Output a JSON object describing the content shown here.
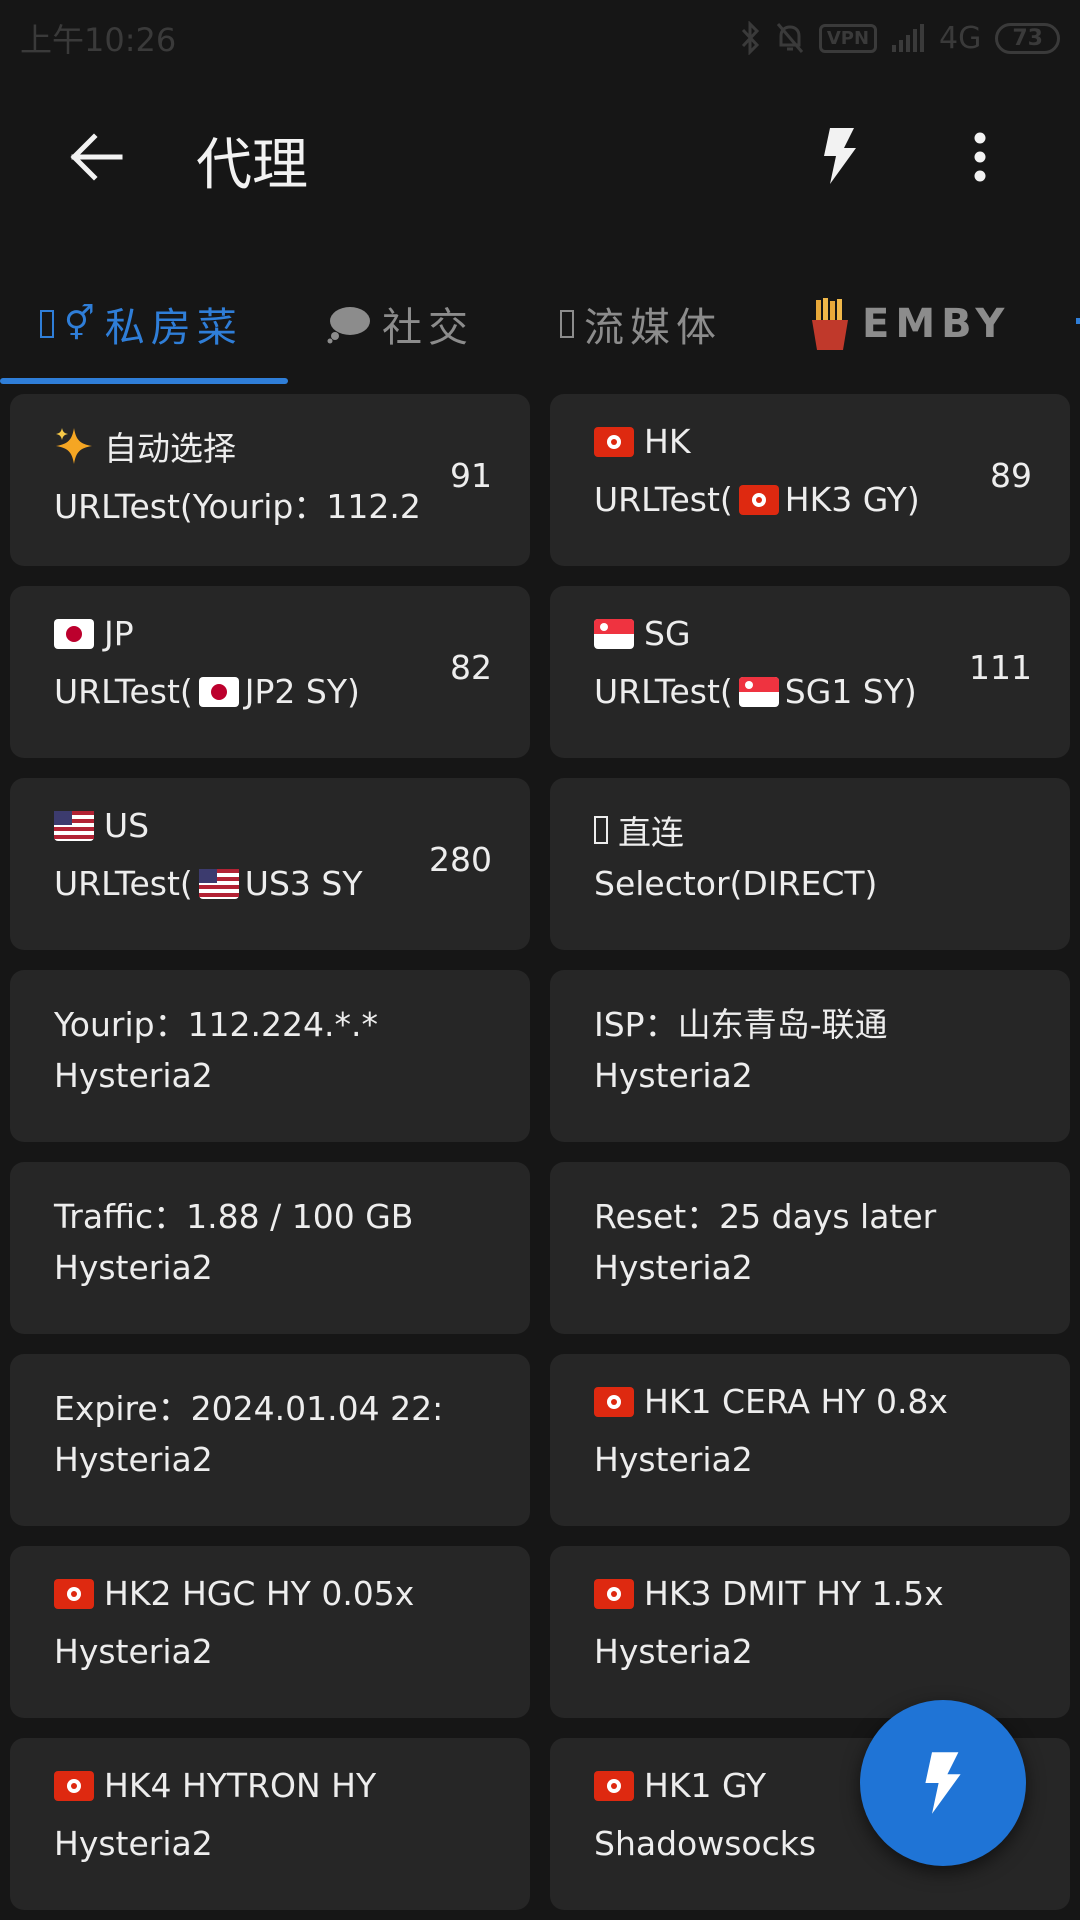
{
  "status_bar": {
    "time": "上午10:26",
    "vpn": "VPN",
    "network": "4G",
    "battery": "73"
  },
  "toolbar": {
    "title": "代理"
  },
  "tabs": [
    {
      "label": "私房菜",
      "active": true
    },
    {
      "label": "社交",
      "active": false
    },
    {
      "label": "流媒体",
      "active": false
    },
    {
      "label": "EMBY",
      "active": false
    }
  ],
  "colors": {
    "accent": "#2f7ed8",
    "card_bg": "#262626",
    "background": "#161616"
  },
  "cards": [
    {
      "icon": "sparkle",
      "name": "自动选择",
      "detail": "URLTest(Yourip：112.2",
      "latency": "91"
    },
    {
      "icon": "hk-flag",
      "name": "HK",
      "detail_prefix": "URLTest(",
      "detail_flag": "hk-flag",
      "detail_suffix": " HK3 GY)",
      "latency": "89"
    },
    {
      "icon": "jp-flag",
      "name": "JP",
      "detail_prefix": "URLTest(",
      "detail_flag": "jp-flag",
      "detail_suffix": " JP2 SY)",
      "latency": "82"
    },
    {
      "icon": "sg-flag",
      "name": "SG",
      "detail_prefix": "URLTest(",
      "detail_flag": "sg-flag",
      "detail_suffix": " SG1 SY)",
      "latency": "111"
    },
    {
      "icon": "us-flag",
      "name": "US",
      "detail_prefix": "URLTest(",
      "detail_flag": "us-flag",
      "detail_suffix": " US3 SY",
      "latency": "280"
    },
    {
      "icon": "tofu",
      "name": "直连",
      "detail": "Selector(DIRECT)",
      "latency": ""
    },
    {
      "icon": "",
      "name": "Yourip：112.224.*.*",
      "detail": "Hysteria2",
      "latency": ""
    },
    {
      "icon": "",
      "name": "ISP：山东青岛-联通",
      "detail": "Hysteria2",
      "latency": ""
    },
    {
      "icon": "",
      "name": "Traffic：1.88 / 100 GB",
      "detail": "Hysteria2",
      "latency": ""
    },
    {
      "icon": "",
      "name": "Reset：25 days later",
      "detail": "Hysteria2",
      "latency": ""
    },
    {
      "icon": "",
      "name": "Expire：2024.01.04 22:",
      "detail": "Hysteria2",
      "latency": ""
    },
    {
      "icon": "hk-flag",
      "name": "HK1 CERA HY 0.8x",
      "detail": "Hysteria2",
      "latency": ""
    },
    {
      "icon": "hk-flag",
      "name": "HK2 HGC HY 0.05x",
      "detail": "Hysteria2",
      "latency": ""
    },
    {
      "icon": "hk-flag",
      "name": "HK3 DMIT HY 1.5x",
      "detail": "Hysteria2",
      "latency": ""
    },
    {
      "icon": "hk-flag",
      "name": "HK4 HYTRON HY",
      "detail": "Hysteria2",
      "latency": ""
    },
    {
      "icon": "hk-flag",
      "name": "HK1 GY",
      "detail": "Shadowsocks",
      "latency": ""
    }
  ]
}
